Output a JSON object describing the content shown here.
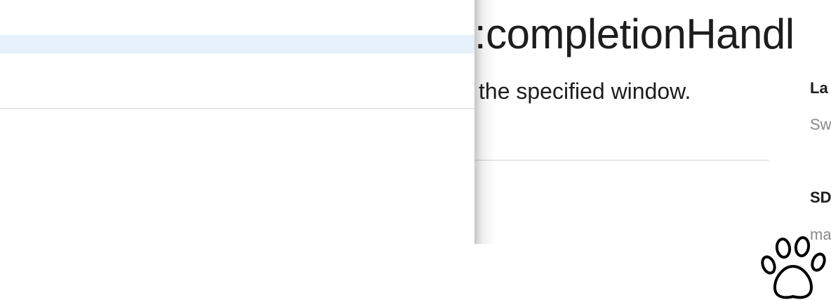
{
  "left_pane": {
    "selected_row_label": ""
  },
  "doc": {
    "title": ":completionHandl",
    "abstract": "the specified window.",
    "sidebar": {
      "language_heading": "La",
      "language_value": "Sw",
      "sdk_heading": "SD",
      "sdk_value": "ma"
    }
  },
  "overlay": {
    "icon": "paw-icon"
  },
  "colors": {
    "selection": "#e6f1fb",
    "text": "#1d1d1f",
    "secondary_text": "#8a8a8a",
    "divider": "#d6d6d6"
  }
}
